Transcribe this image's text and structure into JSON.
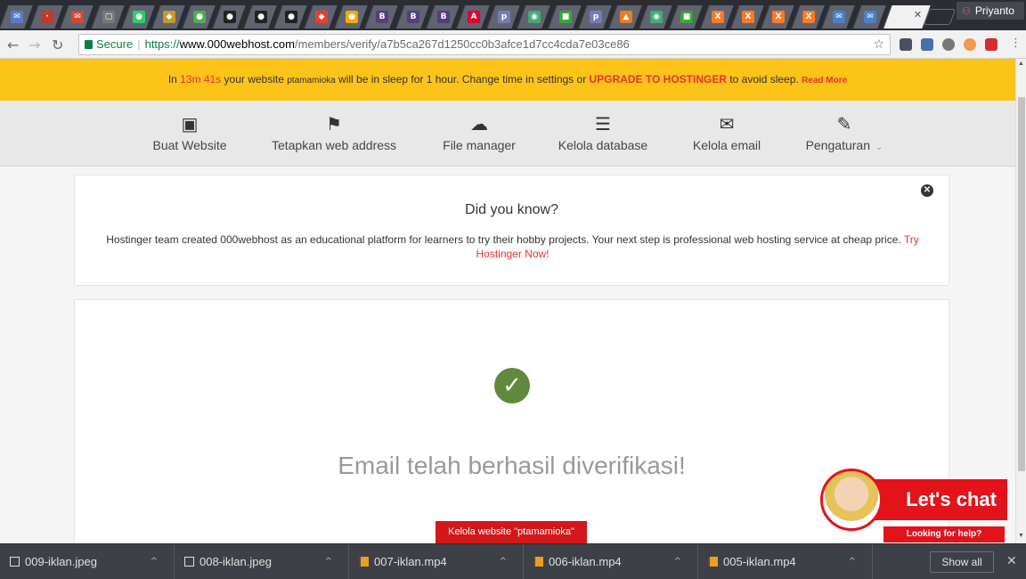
{
  "browser": {
    "profile_name": "Priyanto",
    "tabs": [
      {
        "icon": "gmail-icon",
        "glyph": "✉",
        "color": "#5a79c9"
      },
      {
        "icon": "tab-icon-red",
        "glyph": "·",
        "color": "#c0392b"
      },
      {
        "icon": "gmail-icon",
        "glyph": "✉",
        "color": "#d14836"
      },
      {
        "icon": "document-icon",
        "glyph": "▢",
        "color": "#777"
      },
      {
        "icon": "whatsapp-icon",
        "glyph": "●",
        "color": "#25d366"
      },
      {
        "icon": "tab-icon-yellow",
        "glyph": "◆",
        "color": "#c49a2c"
      },
      {
        "icon": "leaf-icon",
        "glyph": "●",
        "color": "#4caf50"
      },
      {
        "icon": "github-icon",
        "glyph": "●",
        "color": "#222"
      },
      {
        "icon": "github-icon",
        "glyph": "●",
        "color": "#222"
      },
      {
        "icon": "github-icon",
        "glyph": "●",
        "color": "#222"
      },
      {
        "icon": "gitlab-icon",
        "glyph": "◆",
        "color": "#e24329"
      },
      {
        "icon": "tab-icon-orange",
        "glyph": "●",
        "color": "#f2a900"
      },
      {
        "icon": "bootstrap-icon",
        "glyph": "B",
        "color": "#563d7c"
      },
      {
        "icon": "bootstrap-icon",
        "glyph": "B",
        "color": "#563d7c"
      },
      {
        "icon": "bootstrap-icon",
        "glyph": "B",
        "color": "#563d7c"
      },
      {
        "icon": "angular-icon",
        "glyph": "A",
        "color": "#dd0031"
      },
      {
        "icon": "php-icon",
        "glyph": "p",
        "color": "#777bb4"
      },
      {
        "icon": "globe-icon",
        "glyph": "◉",
        "color": "#4a7"
      },
      {
        "icon": "tab-icon-green",
        "glyph": "■",
        "color": "#3a3"
      },
      {
        "icon": "php-icon",
        "glyph": "p",
        "color": "#777bb4"
      },
      {
        "icon": "tab-icon-multi",
        "glyph": "▲",
        "color": "#e67e22"
      },
      {
        "icon": "globe-icon",
        "glyph": "◉",
        "color": "#4a7"
      },
      {
        "icon": "tab-icon-green",
        "glyph": "■",
        "color": "#3a3"
      },
      {
        "icon": "xampp-icon",
        "glyph": "X",
        "color": "#fb7a24"
      },
      {
        "icon": "xampp-icon",
        "glyph": "X",
        "color": "#fb7a24"
      },
      {
        "icon": "xampp-icon",
        "glyph": "X",
        "color": "#fb7a24"
      },
      {
        "icon": "xampp-icon",
        "glyph": "X",
        "color": "#fb7a24"
      },
      {
        "icon": "mail-icon",
        "glyph": "✉",
        "color": "#4a7fc9"
      },
      {
        "icon": "mail-icon",
        "glyph": "✉",
        "color": "#4a7fc9"
      }
    ],
    "omnibox": {
      "secure_label": "Secure",
      "url_scheme": "https://",
      "url_host": "www.000webhost.com",
      "url_path": "/members/verify/a7b5ca267d1250cc0b3afce1d7cc4cda7e03ce86"
    }
  },
  "banner": {
    "prefix": "In ",
    "timer": "13m 41s",
    "text1": " your website ",
    "site": "ptamamioka",
    "text2": " will be in sleep for 1 hour. Change time in settings or ",
    "upgrade": "UPGRADE TO HOSTINGER",
    "text3": " to avoid sleep. ",
    "read_more": "Read More"
  },
  "nav": {
    "items": [
      {
        "label": "Buat Website",
        "icon": "image-icon"
      },
      {
        "label": "Tetapkan web address",
        "icon": "flag-icon"
      },
      {
        "label": "File manager",
        "icon": "cloud-upload-icon"
      },
      {
        "label": "Kelola database",
        "icon": "database-icon"
      },
      {
        "label": "Kelola email",
        "icon": "envelope-icon"
      },
      {
        "label": "Pengaturan",
        "icon": "wrench-icon"
      }
    ]
  },
  "info_card": {
    "title": "Did you know?",
    "body": "Hostinger team created 000webhost as an educational platform for learners to try their hobby projects. Your next step is professional web hosting service at cheap price. ",
    "link": "Try Hostinger Now!"
  },
  "main": {
    "message": "Email telah berhasil diverifikasi!",
    "manage_label": "Kelola website \"ptamamioka\""
  },
  "chat": {
    "button": "Let's chat",
    "help": "Looking for help?"
  },
  "downloads": {
    "items": [
      {
        "name": "009-iklan.jpeg",
        "type": "image"
      },
      {
        "name": "008-iklan.jpeg",
        "type": "image"
      },
      {
        "name": "007-iklan.mp4",
        "type": "video"
      },
      {
        "name": "006-iklan.mp4",
        "type": "video"
      },
      {
        "name": "005-iklan.mp4",
        "type": "video"
      }
    ],
    "show_all": "Show all"
  },
  "colors": {
    "banner": "#fcc419",
    "accent_red": "#e8322d",
    "success_green": "#5f8a3b"
  }
}
